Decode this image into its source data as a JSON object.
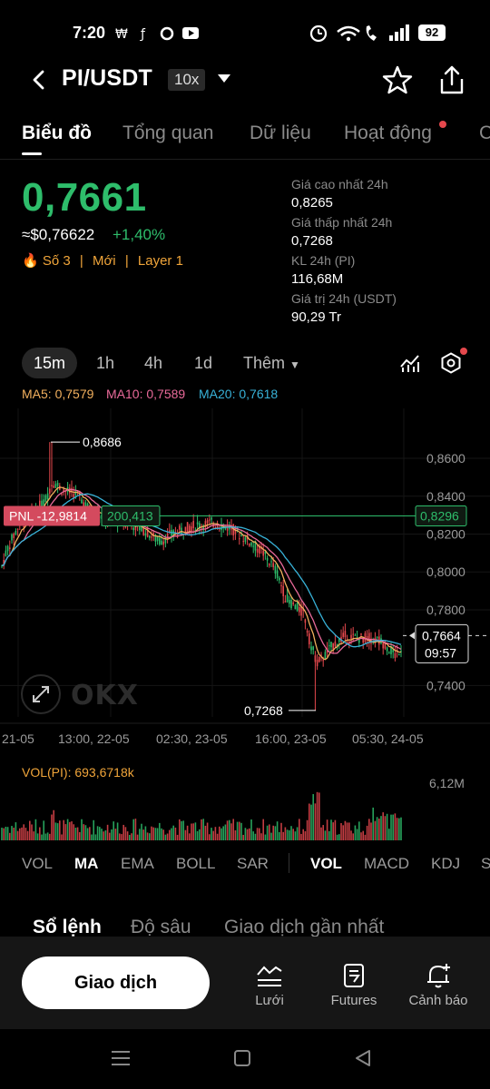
{
  "status_bar": {
    "time": "7:20",
    "battery": "92"
  },
  "header": {
    "pair": "PI/USDT",
    "leverage": "10x"
  },
  "tabs": [
    {
      "label": "Biểu đồ",
      "active": true
    },
    {
      "label": "Tổng quan",
      "active": false
    },
    {
      "label": "Dữ liệu",
      "active": false
    },
    {
      "label": "Hoạt động",
      "active": false
    }
  ],
  "price": {
    "last": "0,7661",
    "usd": "≈$0,76622",
    "change": "+1,40%",
    "rank": "Số 3",
    "tag_new": "Mới",
    "tag_layer": "Layer 1",
    "up_color": "#2ebd6b",
    "down_color": "#e5484d"
  },
  "stats": {
    "high_label": "Giá cao nhất 24h",
    "high": "0,8265",
    "low_label": "Giá thấp nhất 24h",
    "low": "0,7268",
    "vol_label": "KL 24h (PI)",
    "vol": "116,68M",
    "value_label": "Giá trị 24h (USDT)",
    "value": "90,29 Tr"
  },
  "timeframes": {
    "items": [
      "15m",
      "1h",
      "4h",
      "1d"
    ],
    "more": "Thêm",
    "active": "15m"
  },
  "ma_legend": {
    "ma5": "MA5: 0,7579",
    "ma10": "MA10: 0,7589",
    "ma20": "MA20: 0,7618",
    "ma5_color": "#f2b05e",
    "ma10_color": "#e96a9a",
    "ma20_color": "#38b2d8"
  },
  "chart_data": {
    "type": "candlestick",
    "y_ticks": [
      "0,8600",
      "0,8400",
      "0,8200",
      "0,8000",
      "0,7800",
      "0,7400"
    ],
    "ylim": [
      0.733,
      0.872
    ],
    "x_ticks": [
      "21-05",
      "13:00, 22-05",
      "02:30, 23-05",
      "16:00, 23-05",
      "05:30, 24-05"
    ],
    "high_marker": "0,8686",
    "low_marker": "0,7268",
    "pnl_label": "PNL -12,9814",
    "pnl_qty": "200,413",
    "entry_price": "0,8296",
    "current_price": "0,7664",
    "countdown": "09:57",
    "series_ma5_approx": [
      0.808,
      0.822,
      0.83,
      0.842,
      0.833,
      0.826,
      0.817,
      0.817,
      0.823,
      0.825,
      0.822,
      0.816,
      0.806,
      0.778,
      0.774,
      0.762,
      0.757,
      0.763,
      0.766,
      0.763,
      0.761,
      0.758
    ],
    "watermark": "OKX"
  },
  "volume": {
    "label": "VOL(PI): 693,6718k",
    "max": "6,12M"
  },
  "indicators": {
    "main": [
      "VOL",
      "MA",
      "EMA",
      "BOLL",
      "SAR"
    ],
    "main_active": "MA",
    "sub": [
      "VOL",
      "MACD",
      "KDJ"
    ],
    "sub_active": "VOL"
  },
  "orderbook_tabs": [
    "Sổ lệnh",
    "Độ sâu",
    "Giao dịch gần nhất"
  ],
  "bottom_bar": {
    "trade": "Giao dịch",
    "grid": "Lưới",
    "futures": "Futures",
    "alert": "Cảnh báo"
  }
}
